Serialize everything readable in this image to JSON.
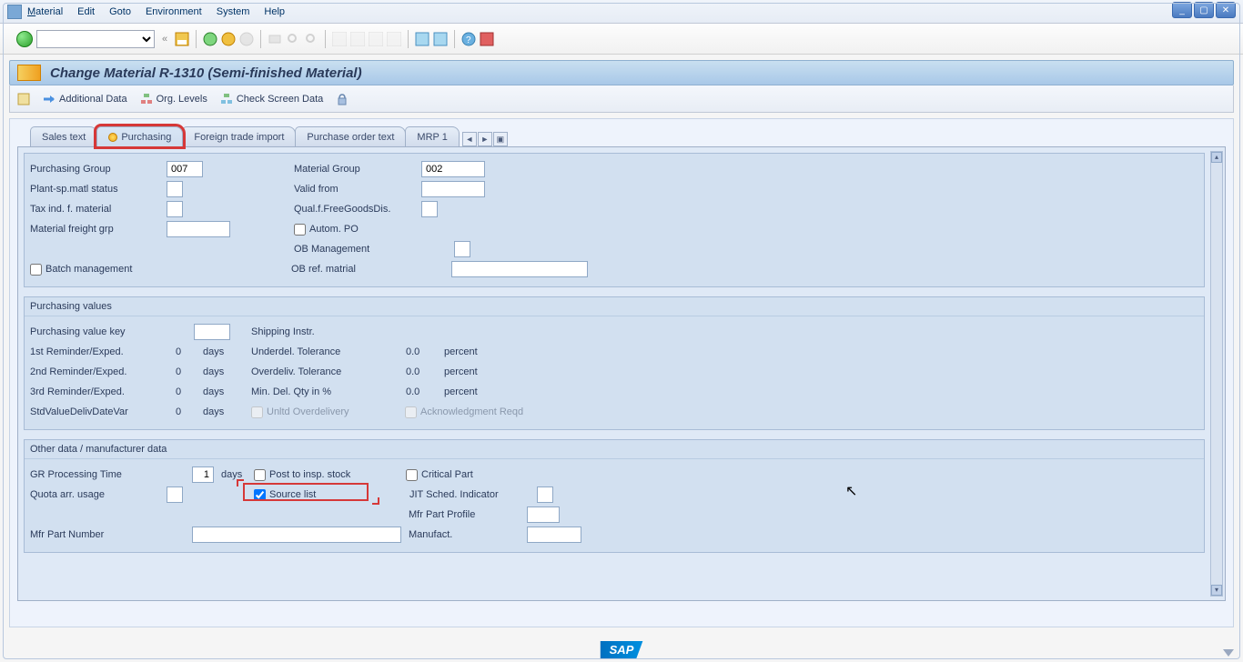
{
  "menu": {
    "material": "Material",
    "edit": "Edit",
    "goto": "Goto",
    "env": "Environment",
    "system": "System",
    "help": "Help"
  },
  "title": "Change Material R-1310 (Semi-finished Material)",
  "apptb": {
    "additional": "Additional Data",
    "org": "Org. Levels",
    "check": "Check Screen Data"
  },
  "tabs": {
    "sales": "Sales text",
    "purchasing": "Purchasing",
    "fti": "Foreign trade import",
    "pot": "Purchase order text",
    "mrp": "MRP 1"
  },
  "general": {
    "purch_group_lbl": "Purchasing Group",
    "purch_group_val": "007",
    "mat_group_lbl": "Material Group",
    "mat_group_val": "002",
    "plant_status_lbl": "Plant-sp.matl status",
    "valid_from_lbl": "Valid from",
    "tax_ind_lbl": "Tax ind. f. material",
    "qual_lbl": "Qual.f.FreeGoodsDis.",
    "freight_lbl": "Material freight grp",
    "autom_po_lbl": "Autom. PO",
    "ob_mgmt_lbl": "OB Management",
    "batch_lbl": "Batch management",
    "ob_ref_lbl": "OB ref. matrial"
  },
  "pv": {
    "title": "Purchasing values",
    "pvk_lbl": "Purchasing value key",
    "ship_lbl": "Shipping Instr.",
    "r1_lbl": "1st Reminder/Exped.",
    "r1_val": "0",
    "days": "days",
    "r2_lbl": "2nd Reminder/Exped.",
    "r2_val": "0",
    "r3_lbl": "3rd Reminder/Exped.",
    "r3_val": "0",
    "std_lbl": "StdValueDelivDateVar",
    "std_val": "0",
    "ud_lbl": "Underdel. Tolerance",
    "ud_val": "0.0",
    "pct": "percent",
    "od_lbl": "Overdeliv. Tolerance",
    "od_val": "0.0",
    "mdq_lbl": "Min. Del. Qty in %",
    "mdq_val": "0.0",
    "unl_lbl": "Unltd Overdelivery",
    "ack_lbl": "Acknowledgment Reqd"
  },
  "od": {
    "title": "Other data / manufacturer data",
    "gr_lbl": "GR Processing Time",
    "gr_val": "1",
    "post_lbl": "Post to insp. stock",
    "crit_lbl": "Critical Part",
    "quota_lbl": "Quota arr. usage",
    "source_lbl": "Source list",
    "jit_lbl": "JIT Sched. Indicator",
    "mfrp_lbl": "Mfr Part Profile",
    "mfrn_lbl": "Mfr Part Number",
    "manuf_lbl": "Manufact."
  },
  "logo": "SAP"
}
